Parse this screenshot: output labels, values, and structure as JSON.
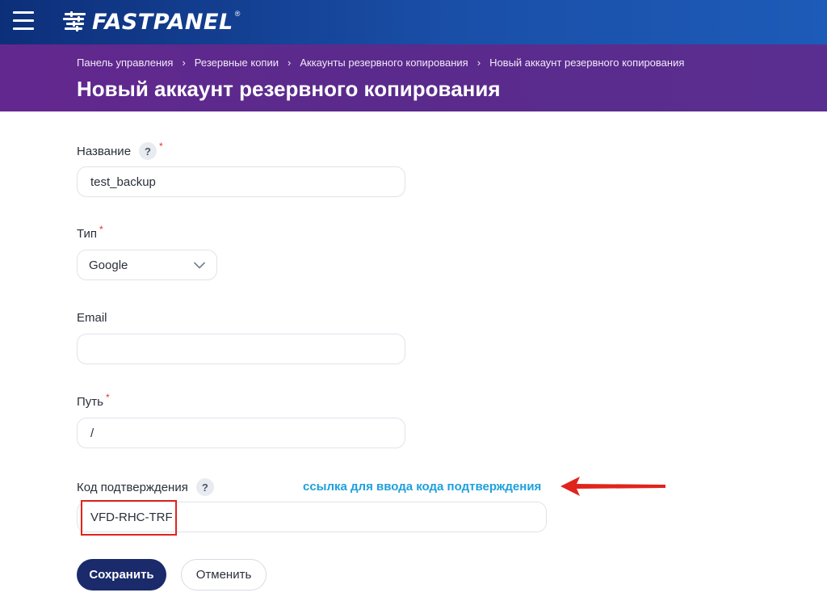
{
  "header": {
    "brand": "FASTPANEL",
    "brand_reg": "®",
    "breadcrumb": [
      "Панель управления",
      "Резервные копии",
      "Аккаунты резервного копирования",
      "Новый аккаунт резервного копирования"
    ],
    "title": "Новый аккаунт резервного копирования"
  },
  "form": {
    "name": {
      "label": "Название",
      "value": "test_backup",
      "required": "*",
      "help": "?"
    },
    "type": {
      "label": "Тип",
      "value": "Google",
      "required": "*"
    },
    "email": {
      "label": "Email",
      "value": ""
    },
    "path": {
      "label": "Путь",
      "value": "/",
      "required": "*"
    },
    "code": {
      "label": "Код подтверждения",
      "help": "?",
      "link": "ссылка для ввода кода подтверждения",
      "value": "VFD-RHC-TRF"
    }
  },
  "actions": {
    "save": "Сохранить",
    "cancel": "Отменить"
  },
  "colors": {
    "topbar": "#1a4fa8",
    "header": "#5a2a8c",
    "primary_button": "#1a2a6b",
    "link": "#1ea0dc",
    "annotation": "#e0241c"
  }
}
